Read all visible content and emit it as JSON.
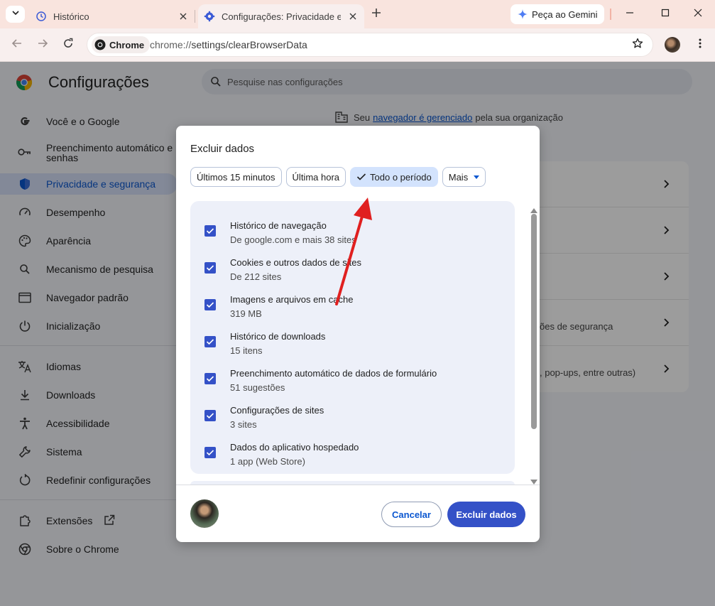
{
  "tabs": {
    "history_title": "Histórico",
    "settings_title": "Configurações: Privacidade e segurança",
    "gemini_label": "Peça ao Gemini"
  },
  "toolbar": {
    "chip_label": "Chrome",
    "url_scheme": "chrome://",
    "url_path": "settings/clearBrowserData"
  },
  "settings": {
    "title": "Configurações",
    "search_placeholder": "Pesquise nas configurações",
    "managed_prefix": "Seu",
    "managed_link": "navegador é gerenciado",
    "managed_suffix": "pela sua organização",
    "nav": [
      {
        "label": "Você e o Google",
        "icon": "google-icon"
      },
      {
        "label": "Preenchimento automático e senhas",
        "icon": "key-icon"
      },
      {
        "label": "Privacidade e segurança",
        "icon": "shield-icon",
        "active": true
      },
      {
        "label": "Desempenho",
        "icon": "speedometer-icon"
      },
      {
        "label": "Aparência",
        "icon": "palette-icon"
      },
      {
        "label": "Mecanismo de pesquisa",
        "icon": "search-icon"
      },
      {
        "label": "Navegador padrão",
        "icon": "browser-icon"
      },
      {
        "label": "Inicialização",
        "icon": "power-icon"
      },
      {
        "label": "Idiomas",
        "icon": "translate-icon"
      },
      {
        "label": "Downloads",
        "icon": "download-icon"
      },
      {
        "label": "Acessibilidade",
        "icon": "accessibility-icon"
      },
      {
        "label": "Sistema",
        "icon": "wrench-icon"
      },
      {
        "label": "Redefinir configurações",
        "icon": "reset-icon"
      },
      {
        "label": "Extensões",
        "icon": "puzzle-icon"
      },
      {
        "label": "Sobre o Chrome",
        "icon": "chrome-icon"
      }
    ],
    "card_partial_1": "ões de segurança",
    "card_partial_2": ", pop-ups, entre outras)"
  },
  "dialog": {
    "title": "Excluir dados",
    "ranges": {
      "r15": "Últimos 15 minutos",
      "hour": "Última hora",
      "all": "Todo o período",
      "more": "Mais"
    },
    "selected_range": "Todo o período",
    "items": [
      {
        "title": "Histórico de navegação",
        "detail": "De google.com e mais 38 sites",
        "checked": true
      },
      {
        "title": "Cookies e outros dados de sites",
        "detail": "De 212 sites",
        "checked": true
      },
      {
        "title": "Imagens e arquivos em cache",
        "detail": "319 MB",
        "checked": true
      },
      {
        "title": "Histórico de downloads",
        "detail": "15 itens",
        "checked": true
      },
      {
        "title": "Preenchimento automático de dados de formulário",
        "detail": "51 sugestões",
        "checked": true
      },
      {
        "title": "Configurações de sites",
        "detail": "3 sites",
        "checked": true
      },
      {
        "title": "Dados do aplicativo hospedado",
        "detail": "1 app (Web Store)",
        "checked": true
      }
    ],
    "cancel_label": "Cancelar",
    "delete_label": "Excluir dados"
  },
  "colors": {
    "accent": "#3451c7",
    "arrow": "#e02020"
  }
}
